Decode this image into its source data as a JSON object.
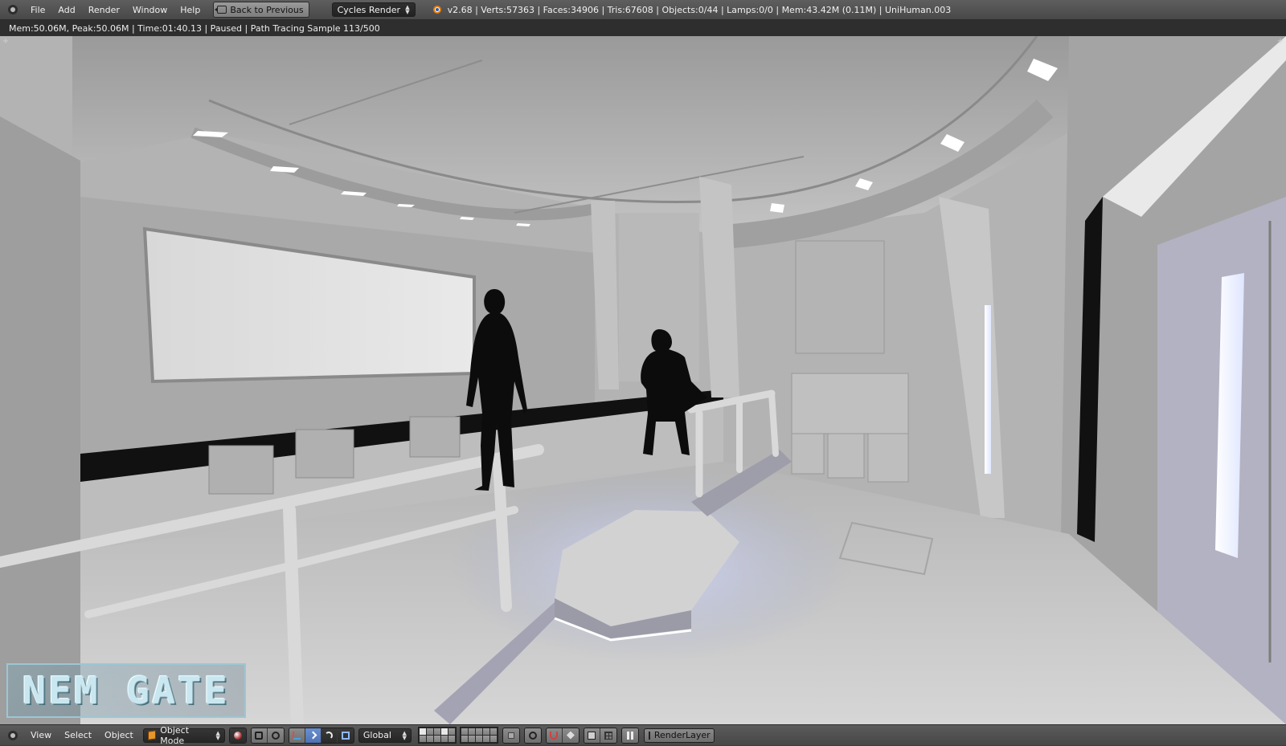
{
  "header": {
    "menus": [
      "File",
      "Add",
      "Render",
      "Window",
      "Help"
    ],
    "back_button": "Back to Previous",
    "render_engine": "Cycles Render",
    "stats": "v2.68 | Verts:57363 | Faces:34906 | Tris:67608 | Objects:0/44 | Lamps:0/0 | Mem:43.42M (0.11M) | UniHuman.003"
  },
  "render_status": "Mem:50.06M, Peak:50.06M | Time:01:40.13 | Paused | Path Tracing Sample 113/500",
  "watermark": "NEM GATE",
  "footer": {
    "menus": [
      "View",
      "Select",
      "Object"
    ],
    "mode": "Object Mode",
    "orientation": "Global",
    "render_layer": "RenderLayer"
  }
}
